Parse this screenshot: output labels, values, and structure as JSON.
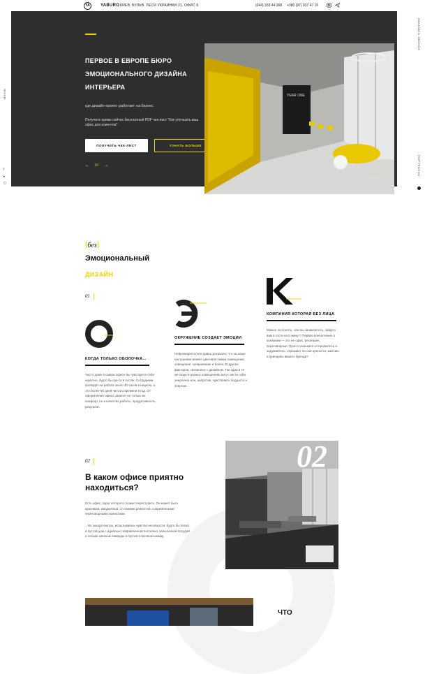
{
  "header": {
    "logo": "YA",
    "brand": "YABURO",
    "address": "КИЕВ, БУЛЬВ. ЛЕСИ УКРАИНКИ 21, ОФИС 6",
    "phone1": "(044) 333 44 368",
    "phone2": "+380 (97) 937 47 15"
  },
  "side": {
    "menu": "МЕНЮ",
    "order": "ЗАКАЗАТЬ ЗВОНОК",
    "portfolio": "ПОРТФОЛИО"
  },
  "hero": {
    "title": "ПЕРВОЕ В ЕВРОПЕ БЮРО ЭМОЦИОНАЛЬНОГО ДИЗАЙНА ИНТЕРЬЕРА",
    "subtitle": "где дизайн-проект работает на бизнес",
    "note": "Получите прямо сейчас бесплатный PDF чек-лист \"Как улучшить ваш офис для клиентов\"",
    "btn_primary": "ПОЛУЧИТЬ ЧЕК-ЛИСТ",
    "btn_secondary": "УЗНАТЬ БОЛЬШЕ",
    "slide_num": "01",
    "prev": "←",
    "next": "→",
    "photo_sign": "YEAR ONE"
  },
  "section1": {
    "bez": "без",
    "title1": "Эмоциональный",
    "title2": "ДИЗАЙН",
    "num": "01",
    "col1": {
      "letter": "О",
      "heading": "КОГДА ТОЛЬКО ОБОЛОЧКА...",
      "text": "Часто даже в самом офисе вы чувствуете себя неуютно, будто бы где-то в гостях. Сотрудники проводят на работе около 40 часов в неделю, а это более 80 дней чистого времени в год. От оформления офиса зависит не только их комфорт, но и качество работы, продуктивность, результат."
    },
    "col2": {
      "letter": "Э",
      "heading": "ОКРУЖЕНИЕ СОЗДАЕТ ЭМОЦИИ",
      "text": "Нейромаркетологи давно доказали, что на наше настроение влияет цветовая гамма помещения, освещение, зонирование и более 25 других факторов, связанных с дизайном. Так одни и те же люди в разных помещениях могут вести себя энергично или, напротив, чувствовать бодрость и энергию."
    },
    "col3": {
      "letter": "К",
      "heading": "КОМПАНИЯ КОТОРАЯ БЕЗ ЛИЦА",
      "text": "Можно ли понять, чем вы занимаетесь, зайдя к вам в гости на 5 минут? Первое впечатление о компании — это ее офис, ресепшен, переговорные. Просто возьмите остановитесь и задумайтесь, отражают ли они ценности, миссию и принципы вашего бренда?"
    }
  },
  "section2": {
    "num": "02",
    "title": "В каком офисе приятно находиться?",
    "p1": "Есть офис, порог которого сложно переступить. Он может быть красивым, аккуратным, со свежим ремонтом, современными переговорными комнатами.",
    "p2": "...Но заходя внутрь, испытываешь чувство неловкости: будто бы попал в пустой дом с идеально заправленной постелью, запыленной посудой и легким запахом лаванды в пустом платяном шкафу.",
    "big_num": "02"
  },
  "section3": {
    "heading": "ЧТО"
  },
  "colors": {
    "accent": "#f2d500",
    "hero_bg": "#2e2e2e"
  }
}
